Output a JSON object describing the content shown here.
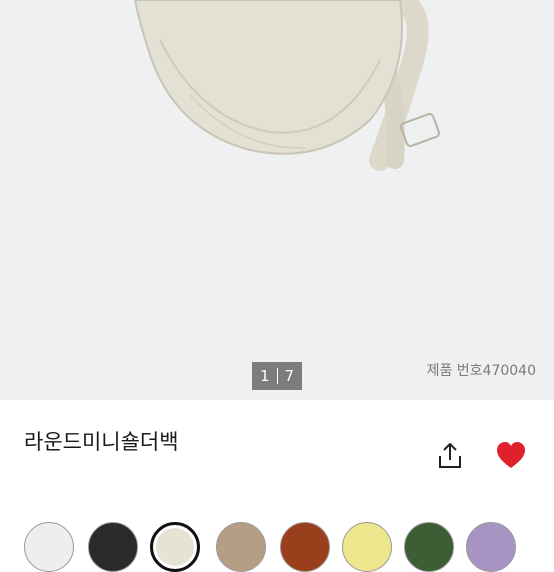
{
  "gallery": {
    "current_page": "1",
    "total_pages": "7",
    "product_number": "제품 번호470040"
  },
  "product": {
    "name": "라운드미니숄더백"
  },
  "actions": {
    "share_icon": "share-icon",
    "favorite_icon": "heart-icon",
    "favorite_color": "#e0202b"
  },
  "colors": {
    "selected_index": 2,
    "swatches": [
      "#eeeeec",
      "#2a2a2c",
      "#e6e2d6",
      "#b69e86",
      "#9a3f1c",
      "#ece68c",
      "#3d5e34",
      "#a794c3"
    ]
  }
}
